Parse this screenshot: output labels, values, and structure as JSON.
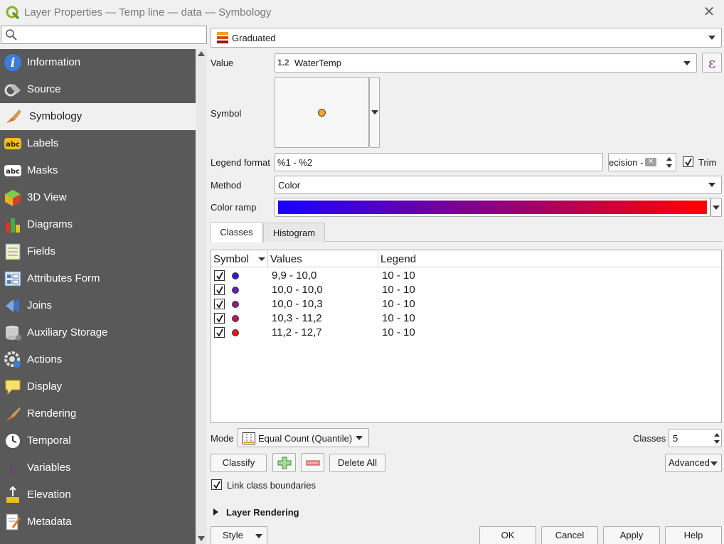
{
  "window": {
    "title": "Layer Properties — Temp line — data — Symbology"
  },
  "search": {
    "placeholder": ""
  },
  "sidebar": {
    "items": [
      {
        "label": "Information",
        "icon": "info-icon"
      },
      {
        "label": "Source",
        "icon": "source-icon"
      },
      {
        "label": "Symbology",
        "icon": "symbology-icon"
      },
      {
        "label": "Labels",
        "icon": "labels-icon"
      },
      {
        "label": "Masks",
        "icon": "masks-icon"
      },
      {
        "label": "3D View",
        "icon": "3d-view-icon"
      },
      {
        "label": "Diagrams",
        "icon": "diagrams-icon"
      },
      {
        "label": "Fields",
        "icon": "fields-icon"
      },
      {
        "label": "Attributes Form",
        "icon": "attributes-form-icon"
      },
      {
        "label": "Joins",
        "icon": "joins-icon"
      },
      {
        "label": "Auxiliary Storage",
        "icon": "auxiliary-storage-icon"
      },
      {
        "label": "Actions",
        "icon": "actions-icon"
      },
      {
        "label": "Display",
        "icon": "display-icon"
      },
      {
        "label": "Rendering",
        "icon": "rendering-icon"
      },
      {
        "label": "Temporal",
        "icon": "temporal-icon"
      },
      {
        "label": "Variables",
        "icon": "variables-icon"
      },
      {
        "label": "Elevation",
        "icon": "elevation-icon"
      },
      {
        "label": "Metadata",
        "icon": "metadata-icon"
      }
    ],
    "active": "Symbology"
  },
  "renderer": {
    "value": "Graduated"
  },
  "value_field": {
    "label": "Value",
    "type_badge": "1.2",
    "value": "WaterTemp"
  },
  "symbol": {
    "label": "Symbol",
    "color": "#f5a623"
  },
  "legend_format": {
    "label": "Legend format",
    "value": "%1 - %2",
    "precision_text": "ecision -",
    "trim_label": "Trim",
    "trim_checked": true
  },
  "method": {
    "label": "Method",
    "value": "Color"
  },
  "color_ramp": {
    "label": "Color ramp",
    "start": "#1a00ff",
    "end": "#ff0000"
  },
  "tabs": [
    {
      "label": "Classes",
      "active": true
    },
    {
      "label": "Histogram",
      "active": false
    }
  ],
  "classes_table": {
    "headers": [
      "Symbol",
      "Values",
      "Legend"
    ],
    "rows": [
      {
        "checked": true,
        "color": "#2a1fd6",
        "values": "9,9 - 10,0",
        "legend": "10 - 10"
      },
      {
        "checked": true,
        "color": "#5b25b8",
        "values": "10,0 - 10,0",
        "legend": "10 - 10"
      },
      {
        "checked": true,
        "color": "#8a1f8a",
        "values": "10,0 - 10,3",
        "legend": "10 - 10"
      },
      {
        "checked": true,
        "color": "#b81a5a",
        "values": "10,3 - 11,2",
        "legend": "10 - 10"
      },
      {
        "checked": true,
        "color": "#e8141e",
        "values": "11,2 - 12,7",
        "legend": "10 - 10"
      }
    ]
  },
  "mode": {
    "label": "Mode",
    "value": "Equal Count (Quantile)"
  },
  "classes_count": {
    "label": "Classes",
    "value": "5"
  },
  "buttons": {
    "classify": "Classify",
    "delete_all": "Delete All",
    "advanced": "Advanced",
    "style": "Style",
    "ok": "OK",
    "cancel": "Cancel",
    "apply": "Apply",
    "help": "Help"
  },
  "link_class_boundaries": {
    "label": "Link class boundaries",
    "checked": true
  },
  "layer_rendering": {
    "label": "Layer Rendering"
  }
}
